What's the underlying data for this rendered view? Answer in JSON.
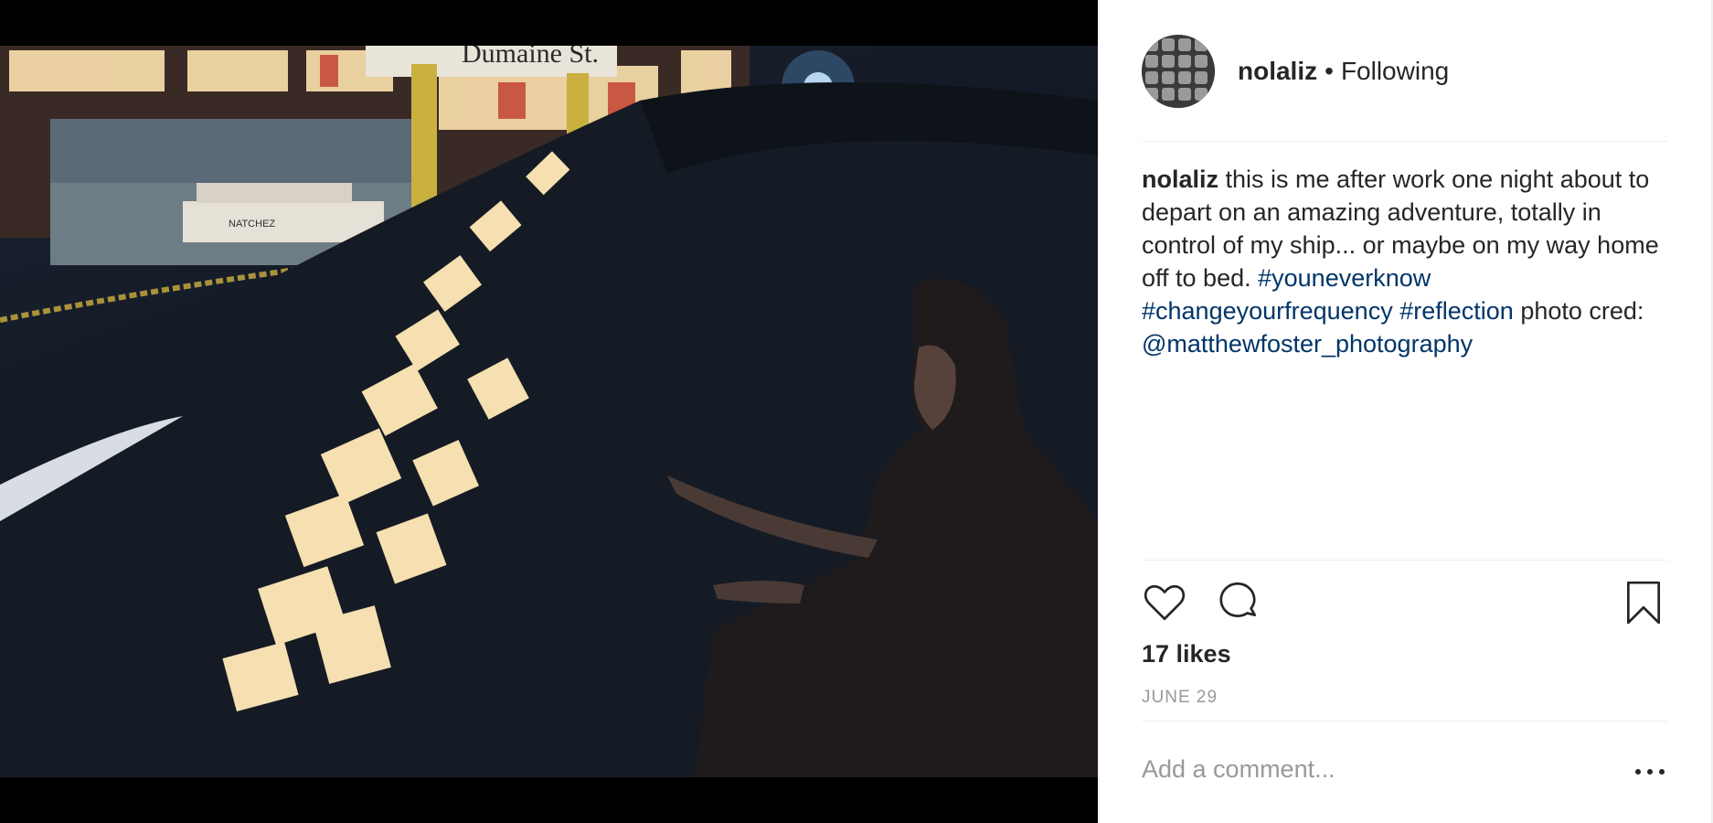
{
  "post": {
    "username": "nolaliz",
    "separator": "•",
    "follow_status": "Following",
    "caption": {
      "username": "nolaliz",
      "text_1": "this is me after work one night about to depart on an amazing adventure, totally in control of my ship... or maybe on my way home off to bed.",
      "tag_1": "#youneverknow",
      "tag_2": "#changeyourfrequency",
      "tag_3": "#reflection",
      "text_2": "photo cred:",
      "mention": "@matthewfoster_photography"
    },
    "likes": "17 likes",
    "date": "JUNE 29",
    "comment_placeholder": "Add a comment..."
  },
  "photo": {
    "sign_text": "Dumaine St.",
    "boat_text": "NATCHEZ"
  },
  "icons": {
    "like": "heart-icon",
    "comment": "speech-bubble-icon",
    "save": "bookmark-icon",
    "more": "more-horizontal-icon"
  },
  "colors": {
    "link": "#003569",
    "text": "#262626",
    "muted": "#999999",
    "divider": "#efefef"
  }
}
